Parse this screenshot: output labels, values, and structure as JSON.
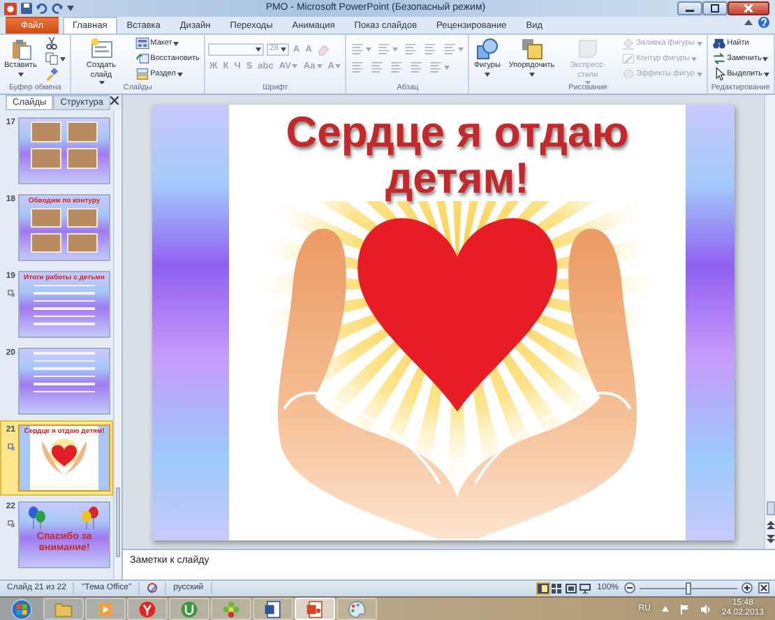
{
  "window": {
    "title": "РМО - Microsoft PowerPoint (Безопасный режим)"
  },
  "ribbon_tabs": [
    {
      "label": "Файл",
      "kind": "file",
      "selected": false
    },
    {
      "label": "Главная",
      "kind": "tab",
      "selected": true
    },
    {
      "label": "Вставка",
      "kind": "tab",
      "selected": false
    },
    {
      "label": "Дизайн",
      "kind": "tab",
      "selected": false
    },
    {
      "label": "Переходы",
      "kind": "tab",
      "selected": false
    },
    {
      "label": "Анимация",
      "kind": "tab",
      "selected": false
    },
    {
      "label": "Показ слайдов",
      "kind": "tab",
      "selected": false
    },
    {
      "label": "Рецензирование",
      "kind": "tab",
      "selected": false
    },
    {
      "label": "Вид",
      "kind": "tab",
      "selected": false
    }
  ],
  "ribbon_groups": [
    {
      "label": "Буфер обмена",
      "columns": [
        [
          {
            "kind": "large",
            "label": "Вставить",
            "dropdown": true,
            "disabled": false
          }
        ],
        [
          {
            "kind": "icon",
            "dropdown": false,
            "disabled": false
          },
          {
            "kind": "icon",
            "dropdown": true,
            "disabled": false
          },
          {
            "kind": "icon",
            "dropdown": false,
            "disabled": false
          }
        ]
      ]
    },
    {
      "label": "Слайды",
      "columns": [
        [
          {
            "kind": "large",
            "label": "Создать слайд",
            "dropdown": true,
            "disabled": false
          }
        ],
        [
          {
            "kind": "small",
            "label": "Макет",
            "dropdown": true,
            "disabled": false
          },
          {
            "kind": "small",
            "label": "Восстановить",
            "dropdown": false,
            "disabled": false
          },
          {
            "kind": "small",
            "label": "Раздел",
            "dropdown": true,
            "disabled": false
          }
        ]
      ]
    },
    {
      "label": "Шрифт",
      "columns": [
        [
          {
            "kind": "field",
            "dropdown": true,
            "disabled": true
          },
          {
            "kind": "field",
            "value": "28",
            "dropdown": true,
            "disabled": true
          },
          {
            "kind": "glyph",
            "label": "A",
            "dropdown": false,
            "disabled": true
          },
          {
            "kind": "glyph",
            "label": "A",
            "dropdown": false,
            "disabled": true
          },
          {
            "kind": "icon",
            "dropdown": false,
            "disabled": true
          }
        ],
        [
          {
            "kind": "glyph",
            "label": "Ж",
            "dropdown": false,
            "disabled": true
          },
          {
            "kind": "glyph",
            "label": "К",
            "dropdown": false,
            "disabled": true
          },
          {
            "kind": "glyph",
            "label": "Ч",
            "dropdown": false,
            "disabled": true
          },
          {
            "kind": "glyph",
            "label": "S",
            "dropdown": false,
            "disabled": true
          },
          {
            "kind": "glyph",
            "label": "abc",
            "dropdown": false,
            "disabled": true
          },
          {
            "kind": "glyph",
            "label": "AV",
            "dropdown": true,
            "disabled": true
          },
          {
            "kind": "glyph",
            "label": "Aa",
            "dropdown": true,
            "disabled": true
          },
          {
            "kind": "glyph",
            "label": "A",
            "dropdown": true,
            "disabled": true
          }
        ]
      ]
    },
    {
      "label": "Абзац",
      "columns": [
        [
          {
            "kind": "icon",
            "dropdown": true,
            "disabled": true
          },
          {
            "kind": "icon",
            "dropdown": true,
            "disabled": true
          },
          {
            "kind": "icon",
            "dropdown": false,
            "disabled": true
          },
          {
            "kind": "icon",
            "dropdown": false,
            "disabled": true
          },
          {
            "kind": "icon",
            "dropdown": true,
            "disabled": true
          }
        ],
        [
          {
            "kind": "icon",
            "dropdown": false,
            "disabled": true
          },
          {
            "kind": "icon",
            "dropdown": false,
            "disabled": true
          },
          {
            "kind": "icon",
            "dropdown": false,
            "disabled": true
          },
          {
            "kind": "icon",
            "dropdown": false,
            "disabled": true
          },
          {
            "kind": "icon",
            "dropdown": true,
            "disabled": true
          }
        ]
      ]
    },
    {
      "label": "Рисование",
      "columns": [
        [
          {
            "kind": "large",
            "label": "Фигуры",
            "dropdown": true,
            "disabled": false
          }
        ],
        [
          {
            "kind": "large",
            "label": "Упорядочить",
            "dropdown": true,
            "disabled": false
          }
        ],
        [
          {
            "kind": "large",
            "label": "Экспресс-стили",
            "dropdown": true,
            "disabled": true
          }
        ],
        [
          {
            "kind": "small",
            "label": "Заливка фигуры",
            "dropdown": true,
            "disabled": true
          },
          {
            "kind": "small",
            "label": "Контур фигуры",
            "dropdown": true,
            "disabled": true
          },
          {
            "kind": "small",
            "label": "Эффекты фигур",
            "dropdown": true,
            "disabled": true
          }
        ]
      ]
    },
    {
      "label": "Редактирование",
      "columns": [
        [
          {
            "kind": "small",
            "label": "Найти",
            "dropdown": false,
            "disabled": false
          },
          {
            "kind": "small",
            "label": "Заменить",
            "dropdown": true,
            "disabled": false
          },
          {
            "kind": "small",
            "label": "Выделить",
            "dropdown": true,
            "disabled": false
          }
        ]
      ]
    }
  ],
  "panel_tabs": [
    {
      "label": "Слайды",
      "selected": true
    },
    {
      "label": "Структура",
      "selected": false
    }
  ],
  "slides": [
    {
      "number": "17",
      "kind": "photos",
      "transition": false,
      "selected": false
    },
    {
      "number": "18",
      "kind": "photos",
      "title": "Обводим по контуру",
      "transition": false,
      "selected": false
    },
    {
      "number": "19",
      "kind": "list",
      "title": "Итоги работы с детьми",
      "transition": true,
      "selected": false
    },
    {
      "number": "20",
      "kind": "list",
      "transition": false,
      "selected": false
    },
    {
      "number": "21",
      "kind": "heart",
      "title": "Сердце я отдаю детям!",
      "transition": true,
      "selected": true
    },
    {
      "number": "22",
      "kind": "balloons",
      "title": "Спасибо за внимание!",
      "transition": true,
      "selected": false
    }
  ],
  "slide": {
    "title": "Сердце я отдаю детям!"
  },
  "notes": {
    "placeholder": "Заметки к слайду"
  },
  "status_bar": {
    "items": [
      "Слайд 21 из 22",
      "\"Тема Office\"",
      "русский"
    ],
    "views": [
      {
        "selected": true
      },
      {
        "selected": false
      },
      {
        "selected": false
      },
      {
        "selected": false
      }
    ],
    "zoom": "100%",
    "zoom_slider": {
      "level": 0.5
    }
  },
  "taskbar": {
    "apps": [
      {
        "kind": "folder",
        "selected": false
      },
      {
        "kind": "player",
        "selected": false
      },
      {
        "kind": "browser",
        "selected": false
      },
      {
        "kind": "torrent",
        "selected": false
      },
      {
        "kind": "flower",
        "selected": false
      },
      {
        "kind": "word",
        "selected": false
      },
      {
        "kind": "powerpoint",
        "selected": true
      },
      {
        "kind": "paint",
        "selected": false
      }
    ],
    "language": "RU",
    "time": "15:48",
    "date": "24.02.2013"
  }
}
